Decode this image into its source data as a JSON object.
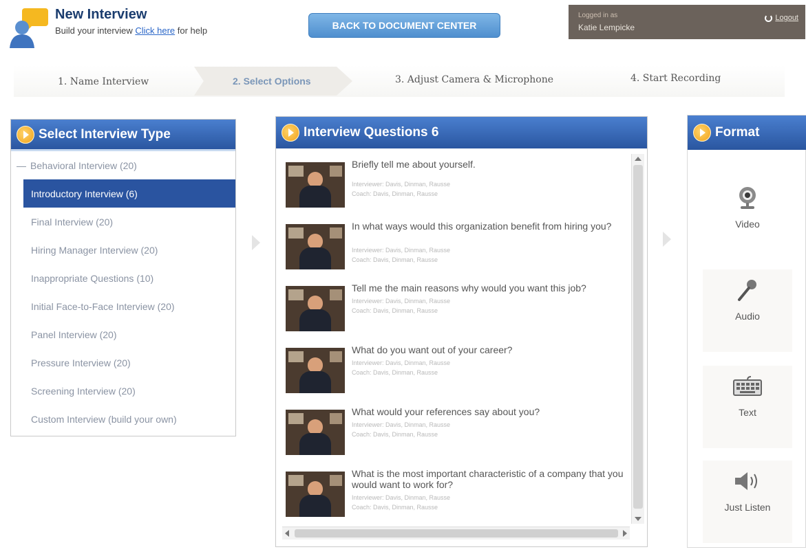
{
  "header": {
    "title": "New Interview",
    "subtitle_prefix": "Build your interview",
    "help_link": "Click here",
    "help_suffix": "for help",
    "back_button": "BACK TO DOCUMENT CENTER",
    "login": {
      "label": "Logged in as",
      "name": "Katie Lempicke",
      "logout": "Logout"
    }
  },
  "steps": [
    {
      "label": "1. Name Interview",
      "active": false
    },
    {
      "label": "2. Select Options",
      "active": true
    },
    {
      "label": "3. Adjust Camera & Microphone",
      "active": false
    },
    {
      "label": "4. Start Recording",
      "active": false
    }
  ],
  "interview_type": {
    "title": "Select Interview Type",
    "items": [
      {
        "label": "Behavioral Interview (20)",
        "prefix": "—"
      },
      {
        "label": "Introductory Interview (6)",
        "selected": true
      },
      {
        "label": "Final Interview (20)"
      },
      {
        "label": "Hiring Manager Interview (20)"
      },
      {
        "label": "Inappropriate Questions (10)"
      },
      {
        "label": "Initial Face-to-Face Interview (20)"
      },
      {
        "label": "Panel Interview (20)"
      },
      {
        "label": "Pressure Interview (20)"
      },
      {
        "label": "Screening Interview (20)"
      },
      {
        "label": "Custom Interview (build your own)"
      }
    ]
  },
  "questions": {
    "title": "Interview Questions 6",
    "items": [
      {
        "text": "Briefly tell me about yourself.",
        "meta1": "Interviewer: Davis, Dinman, Rausse",
        "meta2": "Coach: Davis, Dinman, Rausse"
      },
      {
        "text": "In what ways would this organization benefit from hiring you?",
        "meta1": "Interviewer: Davis, Dinman, Rausse",
        "meta2": "Coach: Davis, Dinman, Rausse"
      },
      {
        "text": "Tell me the main reasons why would you want this job?",
        "meta1": "Interviewer: Davis, Dinman, Rausse",
        "meta2": "Coach: Davis, Dinman, Rausse"
      },
      {
        "text": "What do you want out of your career?",
        "meta1": "Interviewer: Davis, Dinman, Rausse",
        "meta2": "Coach: Davis, Dinman, Rausse"
      },
      {
        "text": "What would your references say about you?",
        "meta1": "Interviewer: Davis, Dinman, Rausse",
        "meta2": "Coach: Davis, Dinman, Rausse"
      },
      {
        "text": "What is the most important characteristic of a company that you would want to work for?",
        "meta1": "Interviewer: Davis, Dinman, Rausse",
        "meta2": "Coach: Davis, Dinman, Rausse"
      }
    ]
  },
  "format": {
    "title": "Format",
    "options": [
      {
        "label": "Video",
        "icon": "webcam-icon"
      },
      {
        "label": "Audio",
        "icon": "microphone-icon"
      },
      {
        "label": "Text",
        "icon": "keyboard-icon"
      },
      {
        "label": "Just Listen",
        "icon": "speaker-icon"
      }
    ]
  },
  "colors": {
    "panel_header": "#2a56a0",
    "selected_item": "#2a54a0",
    "back_button": "#4f8fcf",
    "login_box": "#6b625b"
  }
}
